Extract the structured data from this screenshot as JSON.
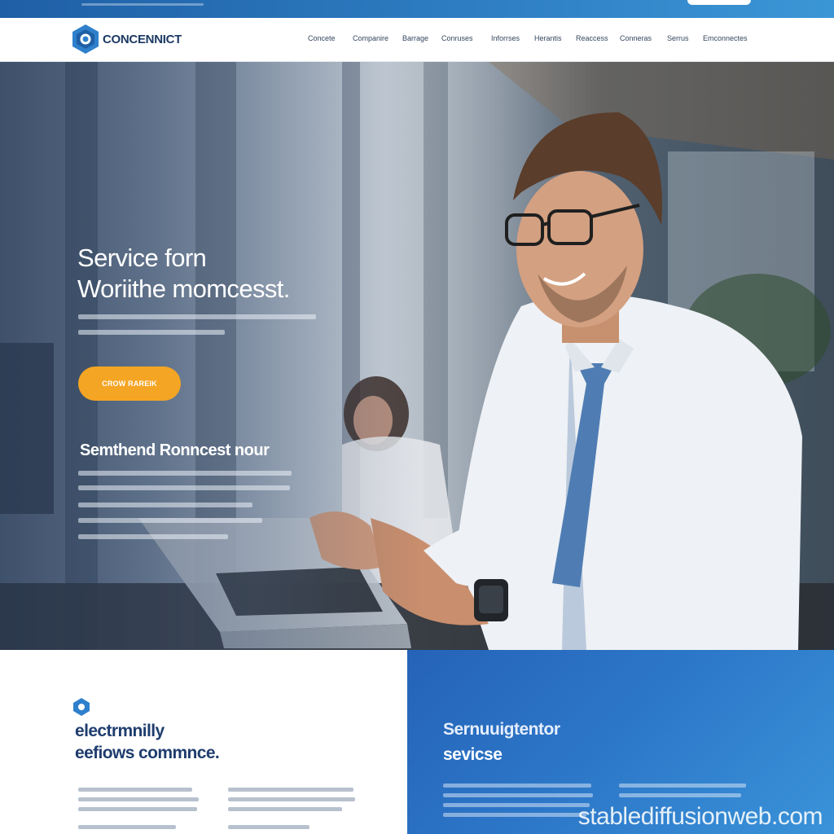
{
  "brand": {
    "name": "CONCENNICT",
    "colors": {
      "primary": "#2563b8",
      "accent": "#f5a524",
      "navy": "#1f3d6e"
    }
  },
  "nav": {
    "items": [
      "Concete",
      "Companire",
      "Barrage",
      "Conruses",
      "Inforrses",
      "Herantis",
      "Reaccess",
      "Conneras",
      "Serrus",
      "Emconnectes"
    ]
  },
  "hero": {
    "title_line1": "Service forn",
    "title_line2": "Woriithe momcesst.",
    "cta_label": "CROW RAREIK",
    "subheading": "Semthend Ronncest nour"
  },
  "feature": {
    "icon": "hexagon-logo-icon",
    "heading_line1": "electrmnilly",
    "heading_line2": "eefiows commnce."
  },
  "services": {
    "heading_line1": "Sernuuigtentor",
    "heading_line2": "sevicse"
  },
  "watermark": "stablediffusionweb.com"
}
